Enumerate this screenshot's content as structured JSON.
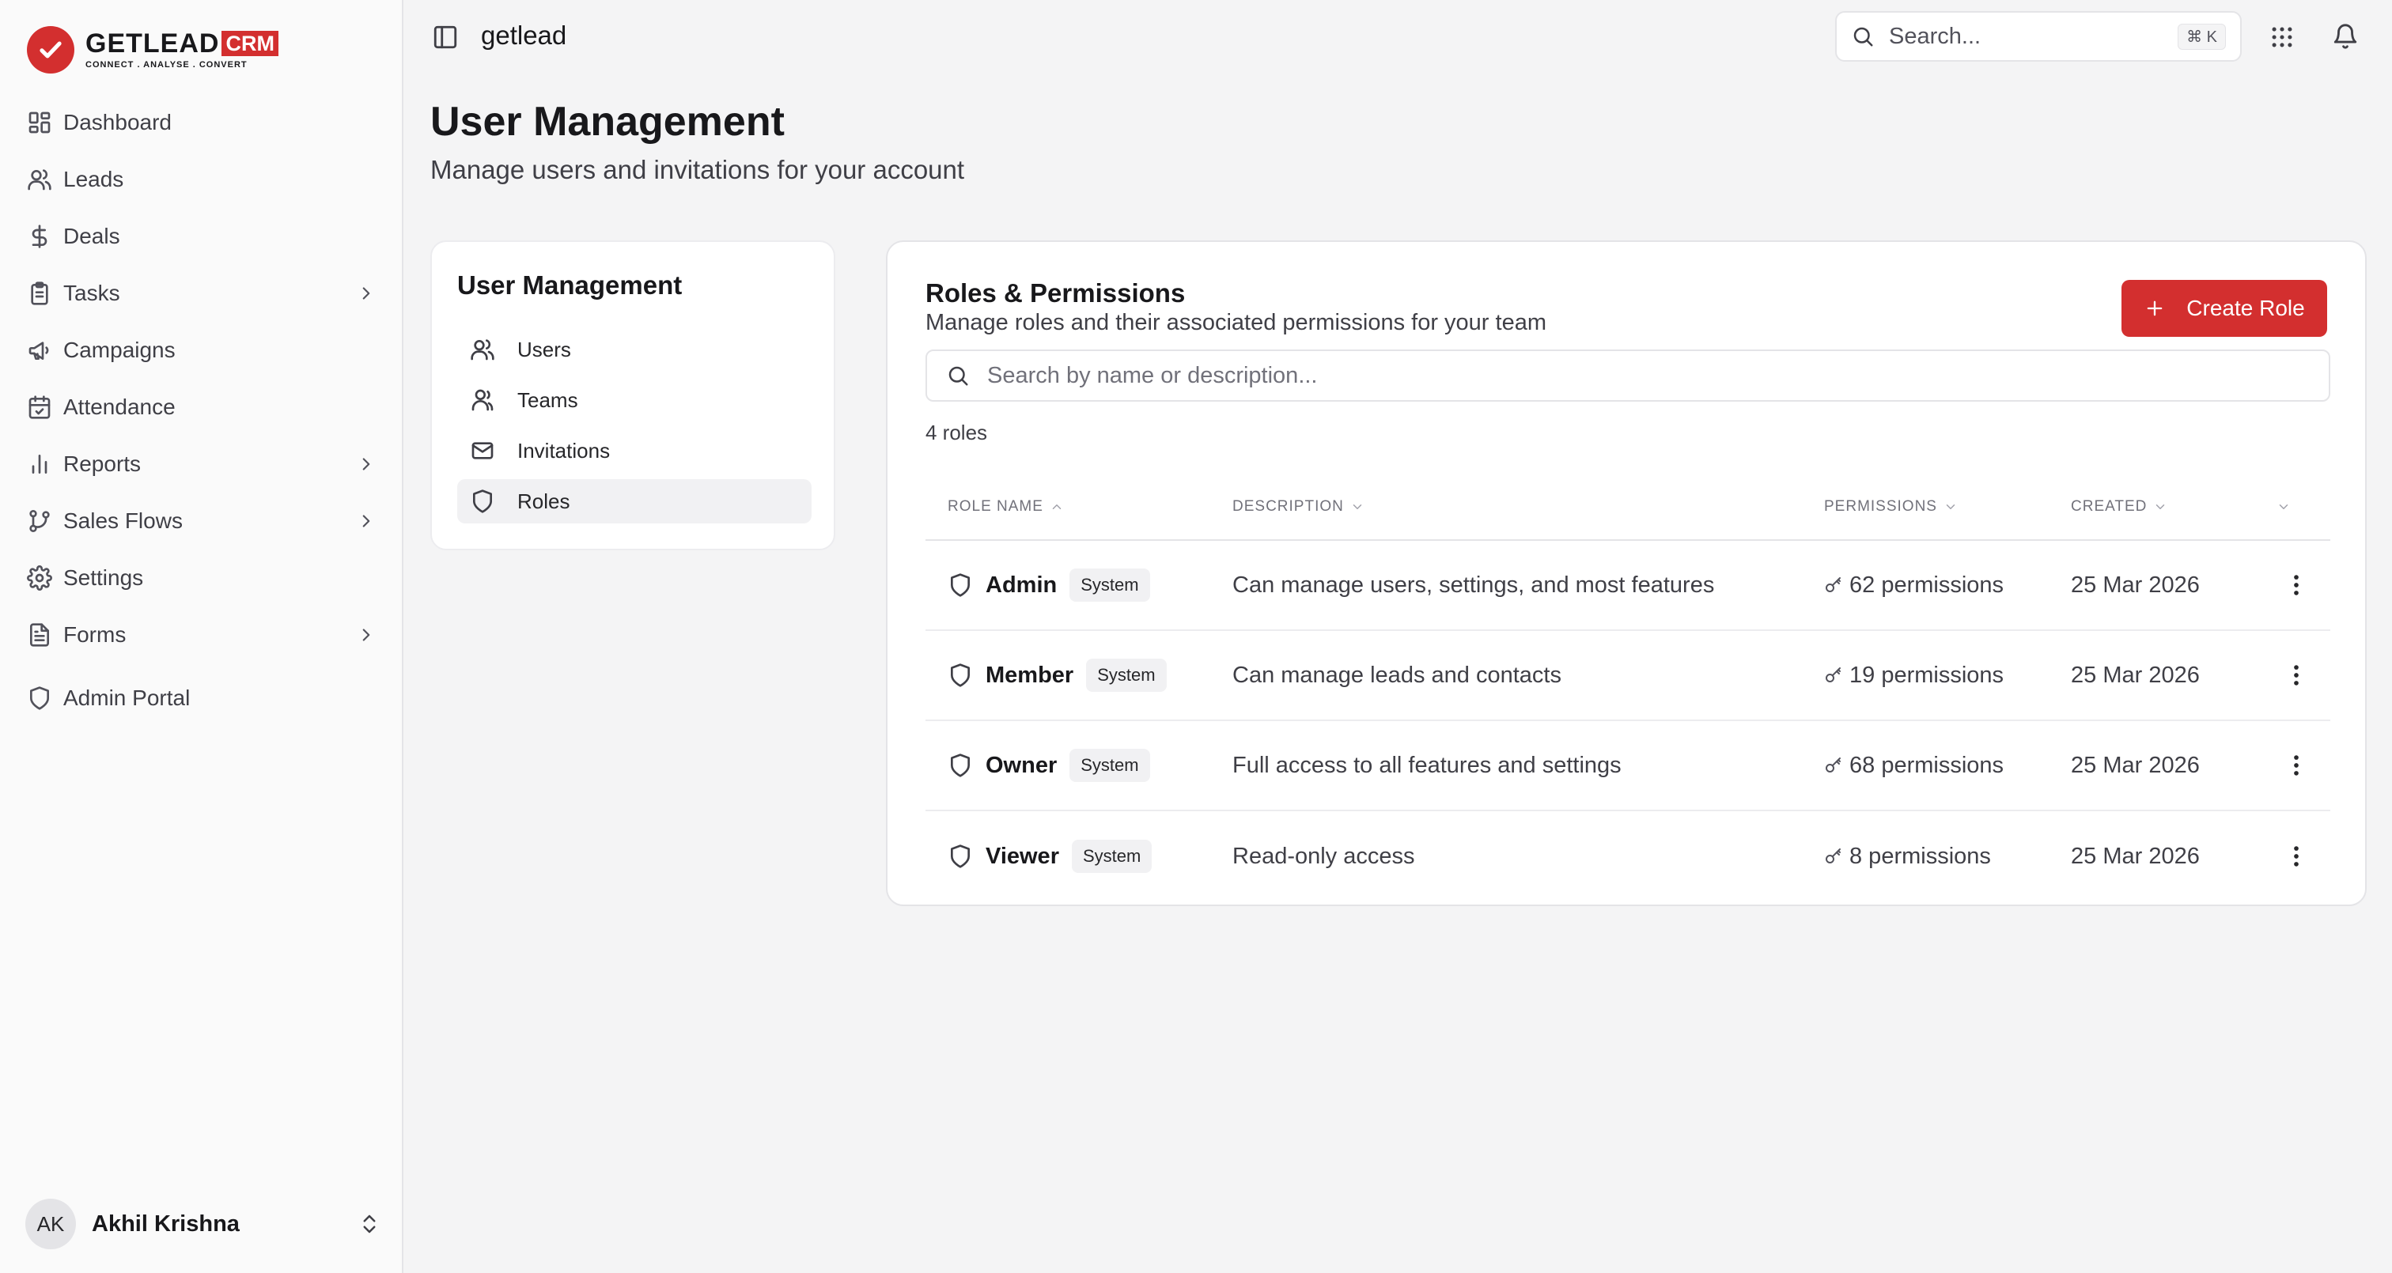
{
  "brand": {
    "word": "GETLEAD",
    "crm": "CRM",
    "tagline": "CONNECT . ANALYSE . CONVERT",
    "accent": "#d32f2f"
  },
  "sidebar": {
    "items": [
      {
        "label": "Dashboard",
        "icon": "grid-icon",
        "chevron": false
      },
      {
        "label": "Leads",
        "icon": "users-icon",
        "chevron": false
      },
      {
        "label": "Deals",
        "icon": "dollar-icon",
        "chevron": false
      },
      {
        "label": "Tasks",
        "icon": "clipboard-icon",
        "chevron": true
      },
      {
        "label": "Campaigns",
        "icon": "megaphone-icon",
        "chevron": false
      },
      {
        "label": "Attendance",
        "icon": "calendar-check-icon",
        "chevron": false
      },
      {
        "label": "Reports",
        "icon": "bar-chart-icon",
        "chevron": true
      },
      {
        "label": "Sales Flows",
        "icon": "git-branch-icon",
        "chevron": true
      },
      {
        "label": "Settings",
        "icon": "gear-icon",
        "chevron": false
      },
      {
        "label": "Forms",
        "icon": "file-text-icon",
        "chevron": true
      },
      {
        "label": "Admin Portal",
        "icon": "shield-icon",
        "chevron": false
      }
    ],
    "user": {
      "initials": "AK",
      "name": "Akhil Krishna"
    }
  },
  "topbar": {
    "workspace": "getlead",
    "search_placeholder": "Search...",
    "shortcut": "⌘ K"
  },
  "page": {
    "title": "User Management",
    "subtitle": "Manage users and invitations for your account"
  },
  "left_card": {
    "title": "User Management",
    "items": [
      {
        "label": "Users",
        "icon": "user-icon"
      },
      {
        "label": "Teams",
        "icon": "users-icon"
      },
      {
        "label": "Invitations",
        "icon": "mail-icon"
      },
      {
        "label": "Roles",
        "icon": "shield-icon"
      }
    ],
    "active": "Roles"
  },
  "roles": {
    "title": "Roles & Permissions",
    "subtitle": "Manage roles and their associated permissions for your team",
    "create_label": "Create Role",
    "search_placeholder": "Search by name or description...",
    "count": "4 roles",
    "columns": {
      "name": "ROLE NAME",
      "description": "DESCRIPTION",
      "permissions": "PERMISSIONS",
      "created": "CREATED"
    },
    "rows": [
      {
        "name": "Admin",
        "badge": "System",
        "description": "Can manage users, settings, and most features",
        "permissions": "62 permissions",
        "created": "25 Mar 2026"
      },
      {
        "name": "Member",
        "badge": "System",
        "description": "Can manage leads and contacts",
        "permissions": "19 permissions",
        "created": "25 Mar 2026"
      },
      {
        "name": "Owner",
        "badge": "System",
        "description": "Full access to all features and settings",
        "permissions": "68 permissions",
        "created": "25 Mar 2026"
      },
      {
        "name": "Viewer",
        "badge": "System",
        "description": "Read-only access",
        "permissions": "8 permissions",
        "created": "25 Mar 2026"
      }
    ]
  }
}
